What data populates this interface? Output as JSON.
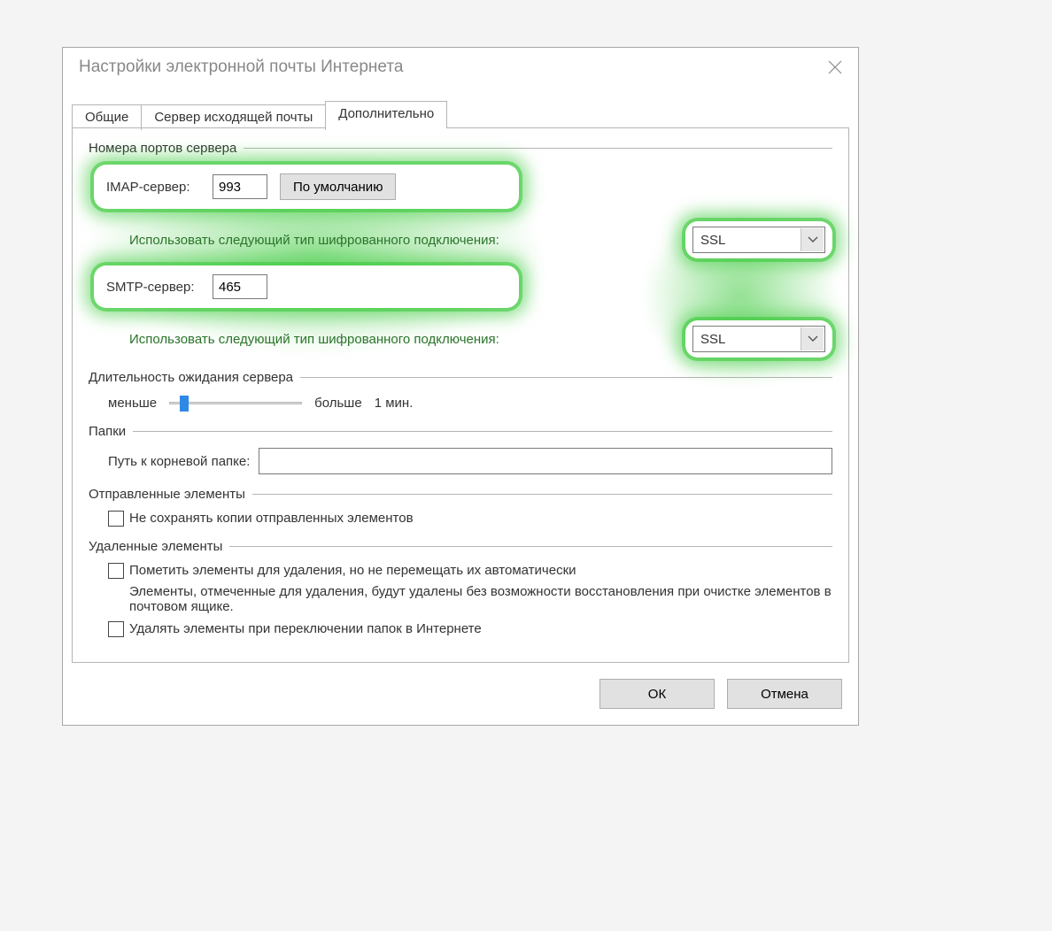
{
  "dialog": {
    "title": "Настройки электронной почты Интернета"
  },
  "tabs": {
    "general": "Общие",
    "outgoing": "Сервер исходящей почты",
    "advanced": "Дополнительно"
  },
  "groups": {
    "ports": "Номера портов сервера",
    "timeout": "Длительность ожидания сервера",
    "folders": "Папки",
    "sent": "Отправленные элементы",
    "deleted": "Удаленные элементы"
  },
  "ports": {
    "imap_label": "IMAP-сервер:",
    "imap_value": "993",
    "default_btn": "По умолчанию",
    "enc_label": "Использовать следующий тип шифрованного подключения:",
    "imap_enc": "SSL",
    "smtp_label": "SMTP-сервер:",
    "smtp_value": "465",
    "smtp_enc": "SSL"
  },
  "timeout": {
    "less": "меньше",
    "more": "больше",
    "value": "1 мин."
  },
  "folders": {
    "root_label": "Путь к корневой папке:",
    "root_value": ""
  },
  "sent": {
    "nosave": "Не сохранять копии отправленных элементов"
  },
  "deleted": {
    "mark": "Пометить элементы для удаления, но не перемещать их автоматически",
    "mark_hint": "Элементы, отмеченные для удаления, будут удалены без возможности восстановления при очистке элементов в почтовом ящике.",
    "purge": "Удалять элементы при переключении папок в Интернете"
  },
  "footer": {
    "ok": "ОК",
    "cancel": "Отмена"
  }
}
